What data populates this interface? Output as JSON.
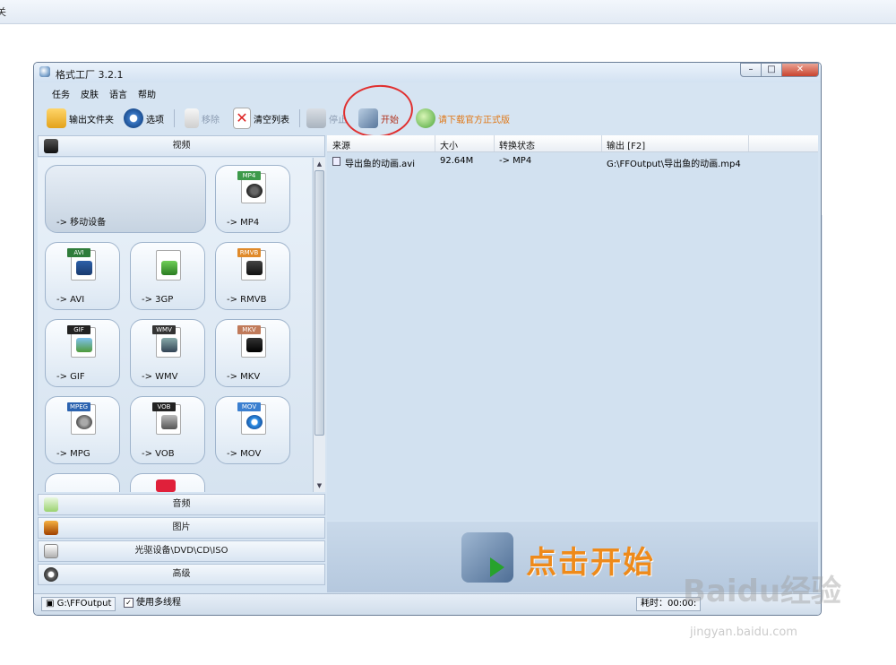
{
  "browser": {
    "edge_text": "关"
  },
  "window": {
    "title": "格式工厂 3.2.1",
    "controls": {
      "minimize": "–",
      "maximize": "□",
      "close": "✕"
    }
  },
  "menu": [
    "任务",
    "皮肤",
    "语言",
    "帮助"
  ],
  "toolbar": {
    "output_folder": "输出文件夹",
    "options": "选项",
    "remove": "移除",
    "clear_list": "清空列表",
    "stop": "停止",
    "start": "开始",
    "download": "请下载官方正式版"
  },
  "categories": {
    "video": "视频",
    "audio": "音频",
    "image": "图片",
    "disc": "光驱设备\\DVD\\CD\\ISO",
    "advanced": "高级"
  },
  "tiles": [
    {
      "label": "-> 移动设备"
    },
    {
      "label": "-> MP4",
      "tag": "MP4"
    },
    {
      "label": "-> AVI",
      "tag": "AVI"
    },
    {
      "label": "-> 3GP",
      "tag": ""
    },
    {
      "label": "-> RMVB",
      "tag": "RMVB"
    },
    {
      "label": "-> GIF",
      "tag": "GIF"
    },
    {
      "label": "-> WMV",
      "tag": "WMV"
    },
    {
      "label": "-> MKV",
      "tag": "MKV"
    },
    {
      "label": "-> MPG",
      "tag": "MPEG"
    },
    {
      "label": "-> VOB",
      "tag": "VOB"
    },
    {
      "label": "-> MOV",
      "tag": "MOV"
    }
  ],
  "list": {
    "columns": [
      "来源",
      "大小",
      "转换状态",
      "输出 [F2]"
    ],
    "rows": [
      {
        "source": "导出鱼的动画.avi",
        "size": "92.64M",
        "status": "-> MP4",
        "output": "G:\\FFOutput\\导出鱼的动画.mp4"
      }
    ]
  },
  "start_banner": "点击开始",
  "status": {
    "output_path": "G:\\FFOutput",
    "multithread": "使用多线程",
    "multithread_checked": "✓",
    "elapsed": "耗时：00:00:"
  },
  "watermark": {
    "text": "Baidu经验",
    "url": "jingyan.baidu.com"
  },
  "annotation_color": "#e03030"
}
